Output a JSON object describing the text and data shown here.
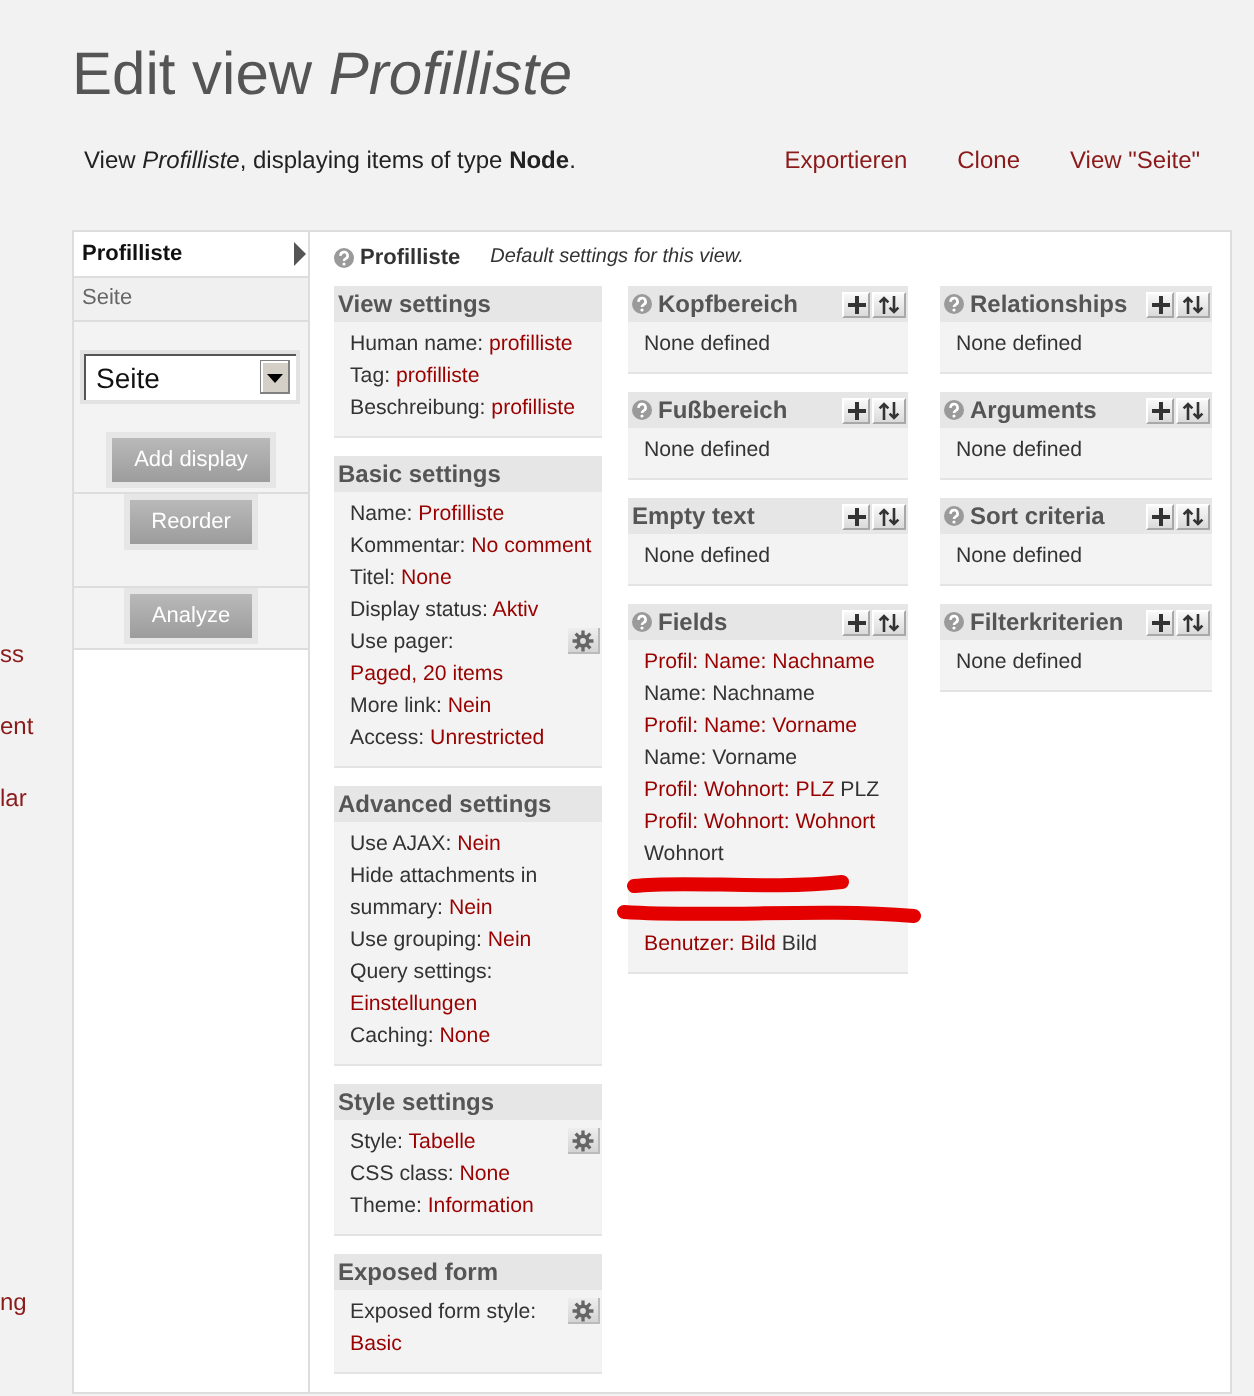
{
  "left_edge_fragments": [
    "ss",
    "ent",
    "lar",
    "ng"
  ],
  "title": "Edit view *Profilliste*",
  "description": "View *Profilliste*, displaying items of type **Node**.",
  "links": [
    "Exportieren",
    "Clone",
    "View \"Seite\""
  ],
  "displays": {
    "tabs": [
      {
        "label": "Profilliste",
        "selected": true
      },
      {
        "label": "Seite",
        "selected": false
      }
    ],
    "select": {
      "value": "Seite"
    },
    "buttons": [
      "Add display",
      "Reorder",
      "Analyze"
    ]
  },
  "display_header": {
    "help_icon": true,
    "title": "Profilliste",
    "note": "Default settings for this view."
  },
  "columns": [
    [
      {
        "title": "View settings",
        "help_icon": false,
        "action_buttons": false,
        "items": [
          {
            "kind": "setting",
            "label": "Human name:",
            "value": "profilliste",
            "gear_button": false
          },
          {
            "kind": "setting",
            "label": "Tag:",
            "value": "profilliste",
            "gear_button": false
          },
          {
            "kind": "setting",
            "label": "Beschreibung:",
            "value": "profilliste",
            "gear_button": false
          }
        ]
      },
      {
        "title": "Basic settings",
        "help_icon": false,
        "action_buttons": false,
        "items": [
          {
            "kind": "setting",
            "label": "Name:",
            "value": "Profilliste",
            "gear_button": false
          },
          {
            "kind": "setting",
            "label": "Kommentar:",
            "value": "No comment",
            "gear_button": false
          },
          {
            "kind": "setting",
            "label": "Titel:",
            "value": "None",
            "gear_button": false
          },
          {
            "kind": "setting",
            "label": "Display status:",
            "value": "Aktiv",
            "gear_button": false
          },
          {
            "kind": "setting",
            "label": "Use pager:",
            "value": "Paged, 20 items",
            "gear_button": true
          },
          {
            "kind": "setting",
            "label": "More link:",
            "value": "Nein",
            "gear_button": false
          },
          {
            "kind": "setting",
            "label": "Access:",
            "value": "Unrestricted",
            "gear_button": false
          }
        ]
      },
      {
        "title": "Advanced settings",
        "help_icon": false,
        "action_buttons": false,
        "items": [
          {
            "kind": "setting",
            "label": "Use AJAX:",
            "value": "Nein",
            "gear_button": false
          },
          {
            "kind": "setting",
            "label": "Hide attachments in summary:",
            "value": "Nein",
            "gear_button": false
          },
          {
            "kind": "setting",
            "label": "Use grouping:",
            "value": "Nein",
            "gear_button": false
          },
          {
            "kind": "setting",
            "label": "Query settings:",
            "value": "Einstellungen",
            "gear_button": false
          },
          {
            "kind": "setting",
            "label": "Caching:",
            "value": "None",
            "gear_button": false
          }
        ]
      },
      {
        "title": "Style settings",
        "help_icon": false,
        "action_buttons": false,
        "items": [
          {
            "kind": "setting",
            "label": "Style:",
            "value": "Tabelle",
            "gear_button": true
          },
          {
            "kind": "setting",
            "label": "CSS class:",
            "value": "None",
            "gear_button": false
          },
          {
            "kind": "setting",
            "label": "Theme:",
            "value": "Information",
            "gear_button": false
          }
        ]
      },
      {
        "title": "Exposed form",
        "help_icon": false,
        "action_buttons": false,
        "items": [
          {
            "kind": "setting",
            "label": "Exposed form style:",
            "value": "Basic",
            "gear_button": true
          }
        ]
      }
    ],
    [
      {
        "title": "Kopfbereich",
        "help_icon": true,
        "action_buttons": true,
        "items": [
          {
            "kind": "empty",
            "text": "None defined"
          }
        ]
      },
      {
        "title": "Fußbereich",
        "help_icon": true,
        "action_buttons": true,
        "items": [
          {
            "kind": "empty",
            "text": "None defined"
          }
        ]
      },
      {
        "title": "Empty text",
        "help_icon": false,
        "action_buttons": true,
        "items": [
          {
            "kind": "empty",
            "text": "None defined"
          }
        ]
      },
      {
        "title": "Fields",
        "help_icon": true,
        "action_buttons": true,
        "items": [
          {
            "kind": "field",
            "link": "Profil: Name: Nachname",
            "label": "Name: Nachname"
          },
          {
            "kind": "field",
            "link": "Profil: Name: Vorname",
            "label": "Name: Vorname"
          },
          {
            "kind": "field",
            "link": "Profil: Wohnort: PLZ",
            "label": "PLZ"
          },
          {
            "kind": "field",
            "link": "Profil: Wohnort: Wohnort",
            "label": "Wohnort"
          },
          {
            "kind": "redacted"
          },
          {
            "kind": "redacted"
          },
          {
            "kind": "field",
            "link": "Benutzer: Bild",
            "label": "Bild"
          }
        ]
      }
    ],
    [
      {
        "title": "Relationships",
        "help_icon": true,
        "action_buttons": true,
        "items": [
          {
            "kind": "empty",
            "text": "None defined"
          }
        ]
      },
      {
        "title": "Arguments",
        "help_icon": true,
        "action_buttons": true,
        "items": [
          {
            "kind": "empty",
            "text": "None defined"
          }
        ]
      },
      {
        "title": "Sort criteria",
        "help_icon": true,
        "action_buttons": true,
        "items": [
          {
            "kind": "empty",
            "text": "None defined"
          }
        ]
      },
      {
        "title": "Filterkriterien",
        "help_icon": true,
        "action_buttons": true,
        "items": [
          {
            "kind": "empty",
            "text": "None defined"
          }
        ]
      }
    ]
  ]
}
